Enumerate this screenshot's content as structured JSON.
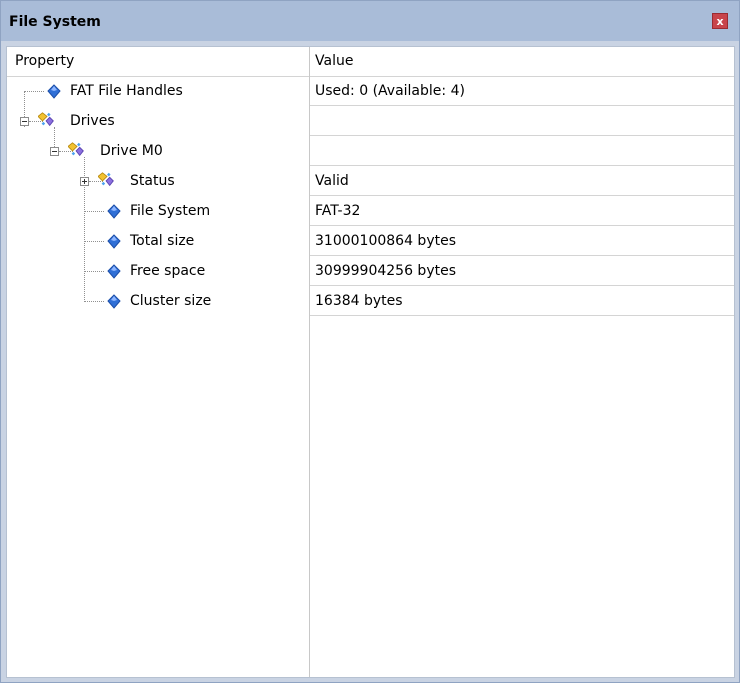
{
  "window": {
    "title": "File System",
    "close_label": "x"
  },
  "columns": {
    "property": "Property",
    "value": "Value"
  },
  "rows": [
    {
      "label": "FAT File Handles",
      "value": "Used: 0 (Available: 4)",
      "icon": "property-diamond-icon"
    },
    {
      "label": "Drives",
      "value": "",
      "icon": "group-node-icon",
      "expanded": true
    },
    {
      "label": "Drive M0",
      "value": "",
      "icon": "group-node-icon",
      "expanded": true
    },
    {
      "label": "Status",
      "value": "Valid",
      "icon": "group-node-icon",
      "expanded": false
    },
    {
      "label": "File System",
      "value": "FAT-32",
      "icon": "property-diamond-icon"
    },
    {
      "label": "Total size",
      "value": "31000100864 bytes",
      "icon": "property-diamond-icon"
    },
    {
      "label": "Free space",
      "value": "30999904256 bytes",
      "icon": "property-diamond-icon"
    },
    {
      "label": "Cluster size",
      "value": "16384 bytes",
      "icon": "property-diamond-icon"
    }
  ],
  "colors": {
    "title_bar": "#a9bcd8",
    "close_button": "#c8444b",
    "diamond": "#2f6fd6"
  }
}
